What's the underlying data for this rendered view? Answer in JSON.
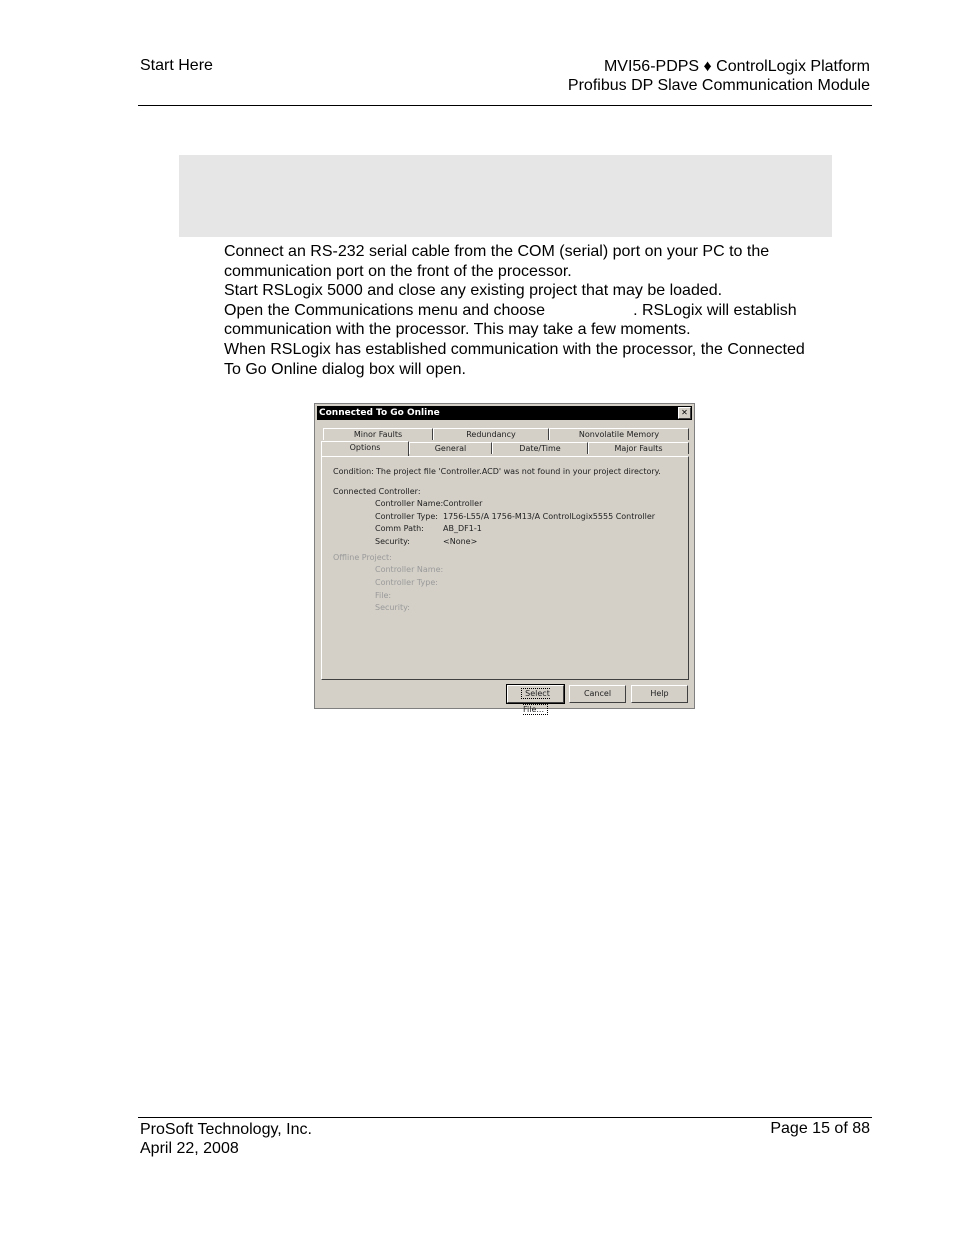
{
  "header": {
    "left": "Start Here",
    "right_line1": "MVI56-PDPS ♦ ControlLogix Platform",
    "right_line2": "Profibus DP Slave Communication Module"
  },
  "body": {
    "step1": "Connect an RS-232 serial cable from the COM (serial) port on your PC to the communication port on the front of the processor.",
    "step2": "Start RSLogix 5000 and close any existing project that may be loaded.",
    "step3a": "Open the Communications menu and choose",
    "step3b": ". RSLogix will establish communication with the processor. This may take a few moments.",
    "step4": "When RSLogix has established communication with the processor, the Connected To Go Online dialog box will open."
  },
  "dialog": {
    "title": "Connected To Go Online",
    "close": "✕",
    "tabs_back": [
      "Minor Faults",
      "Redundancy",
      "Nonvolatile Memory"
    ],
    "tabs_front": [
      "Options",
      "General",
      "Date/Time",
      "Major Faults"
    ],
    "condition_label": "Condition:",
    "condition_text": "The project file 'Controller.ACD' was not found in your project directory.",
    "connected_heading": "Connected Controller:",
    "connected": {
      "name_label": "Controller Name:",
      "name_value": "Controller",
      "type_label": "Controller Type:",
      "type_value": "1756-L55/A 1756-M13/A ControlLogix5555 Controller",
      "path_label": "Comm Path:",
      "path_value": "AB_DF1-1",
      "security_label": "Security:",
      "security_value": "<None>"
    },
    "offline_heading": "Offline Project:",
    "offline": {
      "name_label": "Controller Name:",
      "type_label": "Controller Type:",
      "file_label": "File:",
      "security_label": "Security:"
    },
    "buttons": {
      "select": "Select File...",
      "cancel": "Cancel",
      "help": "Help"
    }
  },
  "footer": {
    "company": "ProSoft Technology, Inc.",
    "date": "April 22, 2008",
    "page": "Page 15 of 88"
  }
}
